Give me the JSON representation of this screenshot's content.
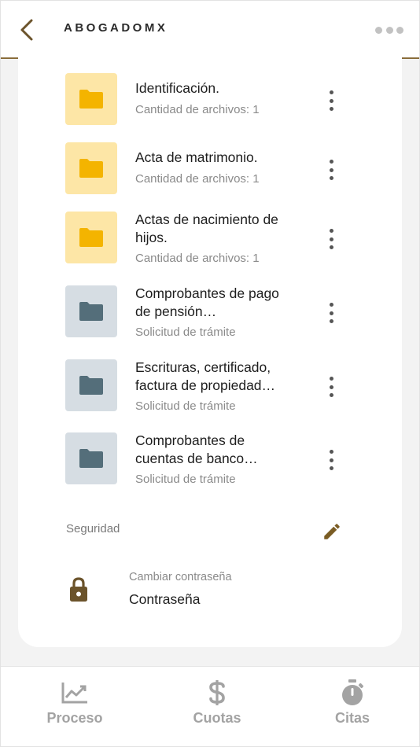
{
  "header": {
    "title": "ABOGADOMX"
  },
  "folders": [
    {
      "title": "Identificación.",
      "subtitle": "Cantidad de archivos: 1",
      "status": "uploaded"
    },
    {
      "title": "Acta de matrimonio.",
      "subtitle": "Cantidad de archivos: 1",
      "status": "uploaded"
    },
    {
      "title": "Actas de nacimiento de hijos.",
      "subtitle": "Cantidad de archivos: 1",
      "status": "uploaded"
    },
    {
      "title": "Comprobantes de pago de pensión…",
      "subtitle": "Solicitud de trámite",
      "status": "requested"
    },
    {
      "title": "Escrituras, certificado, factura de propiedad…",
      "subtitle": "Solicitud de trámite",
      "status": "requested"
    },
    {
      "title": "Comprobantes de cuentas de banco…",
      "subtitle": "Solicitud de trámite",
      "status": "requested"
    }
  ],
  "security": {
    "label": "Seguridad",
    "password_caption": "Cambiar contraseña",
    "password_value": "Contraseña"
  },
  "bottom_nav": [
    {
      "label": "Proceso",
      "icon": "chart-line-icon"
    },
    {
      "label": "Cuotas",
      "icon": "dollar-icon"
    },
    {
      "label": "Citas",
      "icon": "stopwatch-icon"
    }
  ],
  "colors": {
    "brand_brown": "#8a6d3b",
    "folder_yellow_bg": "#fde6a6",
    "folder_yellow_icon": "#f4b400",
    "folder_gray_bg": "#d6dde3",
    "folder_gray_icon": "#546e7a",
    "nav_inactive": "#a3a3a3"
  }
}
